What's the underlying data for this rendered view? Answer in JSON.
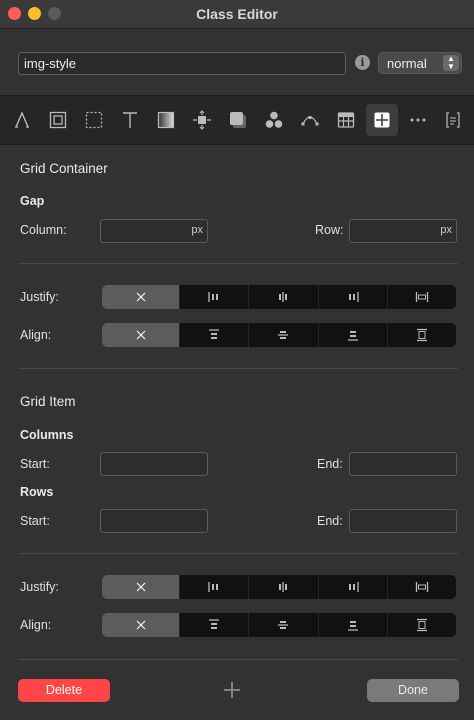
{
  "window": {
    "title": "Class Editor"
  },
  "class_name": {
    "value": "img-style"
  },
  "state_select": {
    "value": "normal"
  },
  "toolbar": {
    "icons": [
      "typography-icon",
      "box-icon",
      "border-icon",
      "text-icon",
      "background-icon",
      "spacing-icon",
      "shadow-icon",
      "effects-icon",
      "transform-icon",
      "table-icon",
      "grid-icon",
      "more-icon",
      "custom-css-icon"
    ],
    "active": "grid-icon"
  },
  "grid_container": {
    "title": "Grid Container",
    "gap_label": "Gap",
    "column_label": "Column:",
    "row_label": "Row:",
    "unit": "px",
    "justify_label": "Justify:",
    "align_label": "Align:"
  },
  "grid_item": {
    "title": "Grid Item",
    "columns_label": "Columns",
    "rows_label": "Rows",
    "start_label": "Start:",
    "end_label": "End:",
    "justify_label": "Justify:",
    "align_label": "Align:"
  },
  "footer": {
    "delete_label": "Delete",
    "done_label": "Done"
  },
  "colors": {
    "delete": "#ff4545",
    "background": "#323232",
    "toolbar": "#262626"
  }
}
